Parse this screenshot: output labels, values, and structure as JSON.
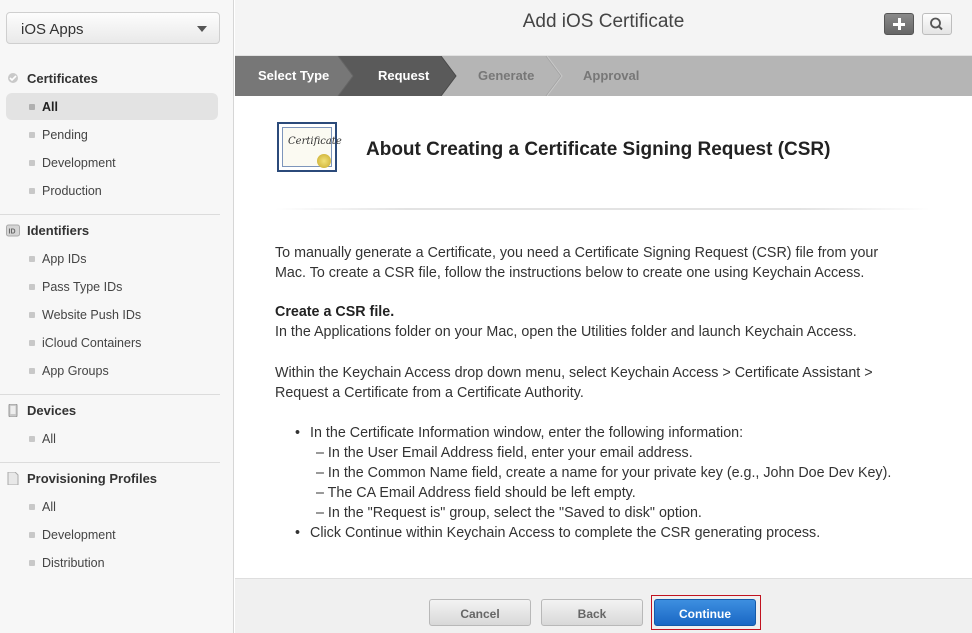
{
  "sidebar": {
    "app_selector": "iOS Apps",
    "sections": [
      {
        "title": "Certificates",
        "icon": "certificate-icon",
        "items": [
          "All",
          "Pending",
          "Development",
          "Production"
        ],
        "active_index": 0
      },
      {
        "title": "Identifiers",
        "icon": "id-icon",
        "items": [
          "App IDs",
          "Pass Type IDs",
          "Website Push IDs",
          "iCloud Containers",
          "App Groups"
        ]
      },
      {
        "title": "Devices",
        "icon": "device-icon",
        "items": [
          "All"
        ]
      },
      {
        "title": "Provisioning Profiles",
        "icon": "document-icon",
        "items": [
          "All",
          "Development",
          "Distribution"
        ]
      }
    ]
  },
  "header": {
    "title": "Add iOS Certificate",
    "add_icon": "plus-icon",
    "search_icon": "search-icon"
  },
  "steps": [
    "Select Type",
    "Request",
    "Generate",
    "Approval"
  ],
  "current_step": "Request",
  "content": {
    "heading": "About Creating a Certificate Signing Request (CSR)",
    "cert_icon_text": "Certificate",
    "intro_1": "To manually generate a Certificate, you need a Certificate Signing Request (CSR) file from your",
    "intro_2": "Mac. To create a CSR file, follow the instructions below to create one using Keychain Access.",
    "create_heading": "Create a CSR file.",
    "create_line": "In the Applications folder on your Mac, open the Utilities folder and launch Keychain Access.",
    "within_1": "Within the Keychain Access drop down menu, select Keychain Access > Certificate Assistant >",
    "within_2": "Request a Certificate from a Certificate Authority.",
    "bullet_1": "In the Certificate Information window, enter the following information:",
    "sub_1": "– In the User Email Address field, enter your email address.",
    "sub_2": "– In the Common Name field, create a name for your private key (e.g., John Doe Dev Key).",
    "sub_3": "– The CA Email Address field should be left empty.",
    "sub_4": "– In the \"Request is\" group, select the \"Saved to disk\" option.",
    "bullet_2": "Click Continue within Keychain Access to complete the CSR generating process."
  },
  "footer": {
    "cancel": "Cancel",
    "back": "Back",
    "continue": "Continue"
  },
  "colors": {
    "accent": "#1a67c4",
    "highlight": "#c1121f",
    "step_active": "#5b5b5b",
    "step_inactive": "#b5b5b5"
  }
}
